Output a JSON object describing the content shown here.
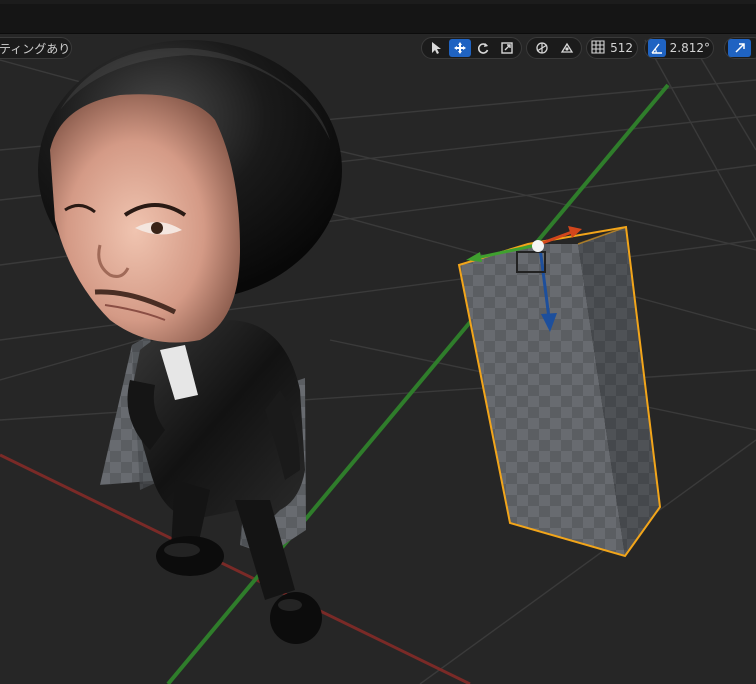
{
  "toolbar": {
    "lighting_label": "ティングあり",
    "tools": [
      {
        "name": "select",
        "icon": "cursor-arrow-icon",
        "active": false
      },
      {
        "name": "translate",
        "icon": "move-arrows-icon",
        "active": true
      },
      {
        "name": "rotate",
        "icon": "rotate-icon",
        "active": false
      },
      {
        "name": "scale",
        "icon": "scale-icon",
        "active": false
      }
    ],
    "extra_icons": [
      "local-axis-icon",
      "surface-snap-icon"
    ],
    "grid_snap_value": "512",
    "rotation_snap_value": "2.812°",
    "colors": {
      "active": "#1f63c2",
      "chip_bg": "#1b1b1b"
    }
  },
  "scene": {
    "colors": {
      "background": "#262626",
      "grid_line": "#3a3a3a",
      "x_axis": "#7a2a27",
      "y_axis": "#2f7d2b",
      "selection_outline": "#f2a51a",
      "gizmo_x": "#d2461c",
      "gizmo_y": "#3fa02f",
      "gizmo_z": "#1d4f9c"
    },
    "objects": [
      {
        "name": "character-figure",
        "selected": false
      },
      {
        "name": "box-mesh",
        "selected": true
      }
    ]
  }
}
